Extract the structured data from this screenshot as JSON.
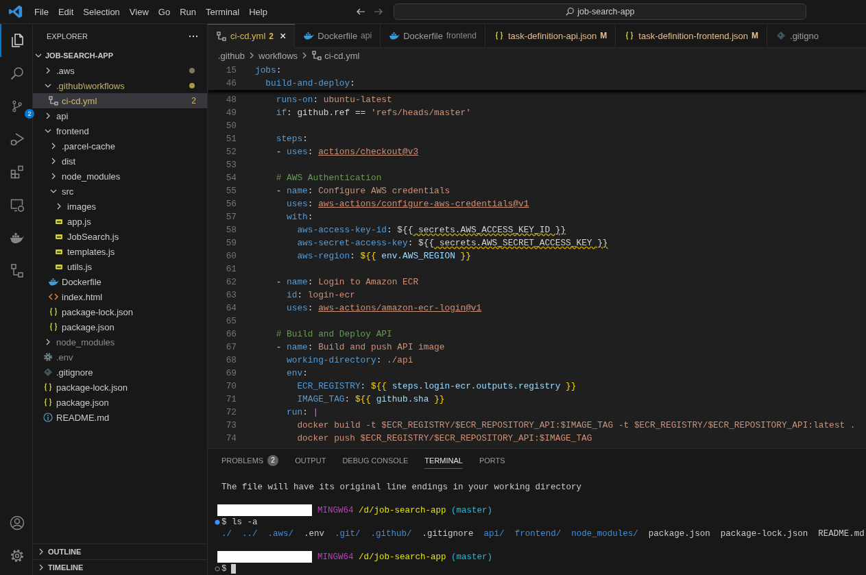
{
  "menu": [
    "File",
    "Edit",
    "Selection",
    "View",
    "Go",
    "Run",
    "Terminal",
    "Help"
  ],
  "title_search": {
    "text": "job-search-app"
  },
  "activity_bar": {
    "items": [
      {
        "kind": "explorer",
        "selected": true
      },
      {
        "kind": "search",
        "selected": false
      },
      {
        "kind": "source-control",
        "selected": false,
        "badge": "2"
      },
      {
        "kind": "run-debug",
        "selected": false
      },
      {
        "kind": "extensions",
        "selected": false
      },
      {
        "kind": "remote",
        "selected": false
      },
      {
        "kind": "docker",
        "selected": false
      },
      {
        "kind": "diagram",
        "selected": false
      }
    ],
    "bottom": [
      {
        "kind": "account"
      },
      {
        "kind": "settings"
      }
    ]
  },
  "explorer": {
    "title": "EXPLORER",
    "project": {
      "label": "JOB-SEARCH-APP",
      "expanded": true
    },
    "tree": [
      {
        "label": ".aws",
        "kind": "folder",
        "expanded": false,
        "has_changes": true,
        "selected": false
      },
      {
        "label": ".github\\workflows",
        "kind": "folder",
        "expanded": true,
        "modified": true,
        "selected": false,
        "children": [
          {
            "label": "ci-cd.yml",
            "kind": "yaml",
            "badge": "2",
            "warning": true,
            "selected": true
          }
        ]
      },
      {
        "label": "api",
        "kind": "folder",
        "expanded": false,
        "selected": false
      },
      {
        "label": "frontend",
        "kind": "folder",
        "expanded": true,
        "selected": false,
        "children": [
          {
            "label": ".parcel-cache",
            "kind": "folder",
            "expanded": false,
            "selected": false
          },
          {
            "label": "dist",
            "kind": "folder",
            "expanded": false,
            "selected": false
          },
          {
            "label": "node_modules",
            "kind": "folder",
            "expanded": false,
            "selected": false
          },
          {
            "label": "src",
            "kind": "folder",
            "expanded": true,
            "selected": false,
            "children": [
              {
                "label": "images",
                "kind": "folder",
                "expanded": false,
                "selected": false
              },
              {
                "label": "app.js",
                "kind": "js",
                "selected": false
              },
              {
                "label": "JobSearch.js",
                "kind": "js",
                "selected": false
              },
              {
                "label": "templates.js",
                "kind": "js",
                "selected": false
              },
              {
                "label": "utils.js",
                "kind": "js",
                "selected": false
              }
            ]
          },
          {
            "label": "Dockerfile",
            "kind": "docker",
            "selected": false
          },
          {
            "label": "index.html",
            "kind": "html",
            "selected": false
          },
          {
            "label": "package-lock.json",
            "kind": "json",
            "selected": false
          },
          {
            "label": "package.json",
            "kind": "json",
            "selected": false
          }
        ]
      },
      {
        "label": "node_modules",
        "kind": "folder",
        "expanded": false,
        "ignored": true,
        "selected": false
      },
      {
        "label": ".env",
        "kind": "env",
        "ignored": true,
        "selected": false
      },
      {
        "label": ".gitignore",
        "kind": "git",
        "selected": false
      },
      {
        "label": "package-lock.json",
        "kind": "json",
        "selected": false
      },
      {
        "label": "package.json",
        "kind": "json",
        "selected": false
      },
      {
        "label": "README.md",
        "kind": "info",
        "selected": false
      }
    ],
    "sections": [
      {
        "label": "OUTLINE",
        "expanded": false
      },
      {
        "label": "TIMELINE",
        "expanded": false
      }
    ]
  },
  "editor": {
    "tabs": [
      {
        "label": "ci-cd.yml",
        "kind": "yaml",
        "selected": true,
        "warning": true,
        "badge": "2",
        "close": "×"
      },
      {
        "label": "Dockerfile",
        "description": "api",
        "kind": "docker",
        "selected": false
      },
      {
        "label": "Dockerfile",
        "description": "frontend",
        "kind": "docker",
        "selected": false
      },
      {
        "label": "task-definition-api.json",
        "kind": "json",
        "selected": false,
        "modified": true,
        "badge": "M"
      },
      {
        "label": "task-definition-frontend.json",
        "kind": "json",
        "selected": false,
        "modified": true,
        "badge": "M"
      },
      {
        "label": ".gitigno",
        "kind": "git",
        "selected": false
      }
    ],
    "breadcrumbs": [
      {
        "label": ".github",
        "kind": "folder"
      },
      {
        "label": "workflows",
        "kind": "folder"
      },
      {
        "label": "ci-cd.yml",
        "kind": "yaml"
      }
    ],
    "sticky_lines": [
      {
        "n": "15",
        "text": "jobs:"
      },
      {
        "n": "46",
        "text": "  build-and-deploy:"
      }
    ],
    "lines": [
      {
        "n": "48",
        "text": "    runs-on: ubuntu-latest"
      },
      {
        "n": "49",
        "text": "    if: github.ref == 'refs/heads/master'"
      },
      {
        "n": "50"
      },
      {
        "n": "51",
        "text": "    steps:"
      },
      {
        "n": "52",
        "text": "    - uses: actions/checkout@v3"
      },
      {
        "n": "53"
      },
      {
        "n": "54",
        "text": "    # AWS Authentication"
      },
      {
        "n": "55",
        "text": "    - name: Configure AWS credentials"
      },
      {
        "n": "56",
        "text": "      uses: aws-actions/configure-aws-credentials@v1"
      },
      {
        "n": "57",
        "text": "      with:"
      },
      {
        "n": "58",
        "text": "        aws-access-key-id: ${{ secrets.AWS_ACCESS_KEY_ID }}",
        "warning": true
      },
      {
        "n": "59",
        "text": "        aws-secret-access-key: ${{ secrets.AWS_SECRET_ACCESS_KEY }}",
        "warning": true
      },
      {
        "n": "60",
        "text": "        aws-region: ${{ env.AWS_REGION }}"
      },
      {
        "n": "61"
      },
      {
        "n": "62",
        "text": "    - name: Login to Amazon ECR"
      },
      {
        "n": "63",
        "text": "      id: login-ecr"
      },
      {
        "n": "64",
        "text": "      uses: aws-actions/amazon-ecr-login@v1"
      },
      {
        "n": "65"
      },
      {
        "n": "66",
        "text": "    # Build and Deploy API"
      },
      {
        "n": "67",
        "text": "    - name: Build and push API image"
      },
      {
        "n": "68",
        "text": "      working-directory: ./api"
      },
      {
        "n": "69",
        "text": "      env:"
      },
      {
        "n": "70",
        "text": "        ECR_REGISTRY: ${{ steps.login-ecr.outputs.registry }}"
      },
      {
        "n": "71",
        "text": "        IMAGE_TAG: ${{ github.sha }}"
      },
      {
        "n": "72",
        "text": "      run: |"
      },
      {
        "n": "73",
        "text": "        docker build -t $ECR_REGISTRY/$ECR_REPOSITORY_API:$IMAGE_TAG -t $ECR_REGISTRY/$ECR_REPOSITORY_API:latest ."
      },
      {
        "n": "74",
        "text": "        docker push $ECR_REGISTRY/$ECR_REPOSITORY_API:$IMAGE_TAG"
      }
    ]
  },
  "panel": {
    "tabs": [
      {
        "label": "PROBLEMS",
        "badge": "2",
        "selected": false
      },
      {
        "label": "OUTPUT",
        "selected": false
      },
      {
        "label": "DEBUG CONSOLE",
        "selected": false
      },
      {
        "label": "TERMINAL",
        "selected": true
      },
      {
        "label": "PORTS",
        "selected": false
      }
    ],
    "terminal": [
      {
        "kind": "text",
        "text": "The file will have its original line endings in your working directory"
      },
      {
        "kind": "blank"
      },
      {
        "kind": "prompt",
        "redacted": true,
        "env": "MINGW64",
        "path": "/d/job-search-app",
        "branch": "(master)"
      },
      {
        "kind": "command",
        "finished": true,
        "text": "$ ls -a"
      },
      {
        "kind": "listing",
        "entries": [
          {
            "text": "./",
            "directory": true
          },
          {
            "text": "../",
            "directory": true
          },
          {
            "text": ".aws/",
            "directory": true
          },
          {
            "text": ".env",
            "directory": false
          },
          {
            "text": ".git/",
            "directory": true
          },
          {
            "text": ".github/",
            "directory": true
          },
          {
            "text": ".gitignore",
            "directory": false
          },
          {
            "text": "api/",
            "directory": true
          },
          {
            "text": "frontend/",
            "directory": true
          },
          {
            "text": "node_modules/",
            "directory": true
          },
          {
            "text": "package.json",
            "directory": false
          },
          {
            "text": "package-lock.json",
            "directory": false
          },
          {
            "text": "README.md",
            "directory": false
          }
        ]
      },
      {
        "kind": "blank"
      },
      {
        "kind": "prompt",
        "redacted": true,
        "env": "MINGW64",
        "path": "/d/job-search-app",
        "branch": "(master)"
      },
      {
        "kind": "command",
        "finished": false,
        "text": "$",
        "cursor": true
      }
    ]
  }
}
